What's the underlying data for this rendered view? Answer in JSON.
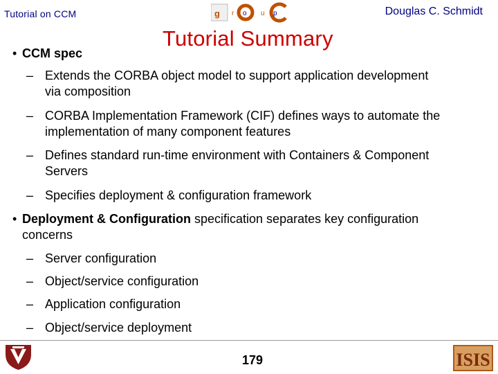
{
  "header": {
    "left_text": "Tutorial on CCM",
    "right_text": "Douglas C. Schmidt",
    "logo": {
      "name": "doc-group-logo",
      "letters": [
        "g",
        "r",
        "o",
        "u",
        "p"
      ],
      "big_letters": [
        "D",
        "O",
        "C"
      ]
    }
  },
  "title": "Tutorial Summary",
  "bullets": [
    {
      "marker": "•",
      "bold": "CCM spec",
      "text": "",
      "sub": [
        {
          "marker": "–",
          "lines": [
            "Extends the CORBA object model to support application development",
            "via composition"
          ]
        },
        {
          "marker": "–",
          "lines": [
            "CORBA Implementation Framework (CIF) defines ways to automate the",
            "implementation of many component features"
          ]
        },
        {
          "marker": "–",
          "lines": [
            "Defines standard run-time environment with Containers & Component",
            "Servers"
          ]
        },
        {
          "marker": "–",
          "lines": [
            "Specifies deployment & configuration framework"
          ]
        }
      ]
    },
    {
      "marker": "•",
      "bold": "Deployment & Configuration",
      "text": " specification separates key configuration",
      "line2": "concerns",
      "sub": [
        {
          "marker": "–",
          "lines": [
            "Server configuration"
          ]
        },
        {
          "marker": "–",
          "lines": [
            "Object/service configuration"
          ]
        },
        {
          "marker": "–",
          "lines": [
            "Application configuration"
          ]
        },
        {
          "marker": "–",
          "lines": [
            "Object/service deployment"
          ]
        }
      ]
    }
  ],
  "footer": {
    "page_number": "179",
    "left_logo": "vanderbilt-logo",
    "right_logo": "isis-logo",
    "right_logo_text": "ISIS"
  },
  "colors": {
    "header_text": "#000080",
    "title": "#cc0000",
    "body_text": "#000000"
  }
}
